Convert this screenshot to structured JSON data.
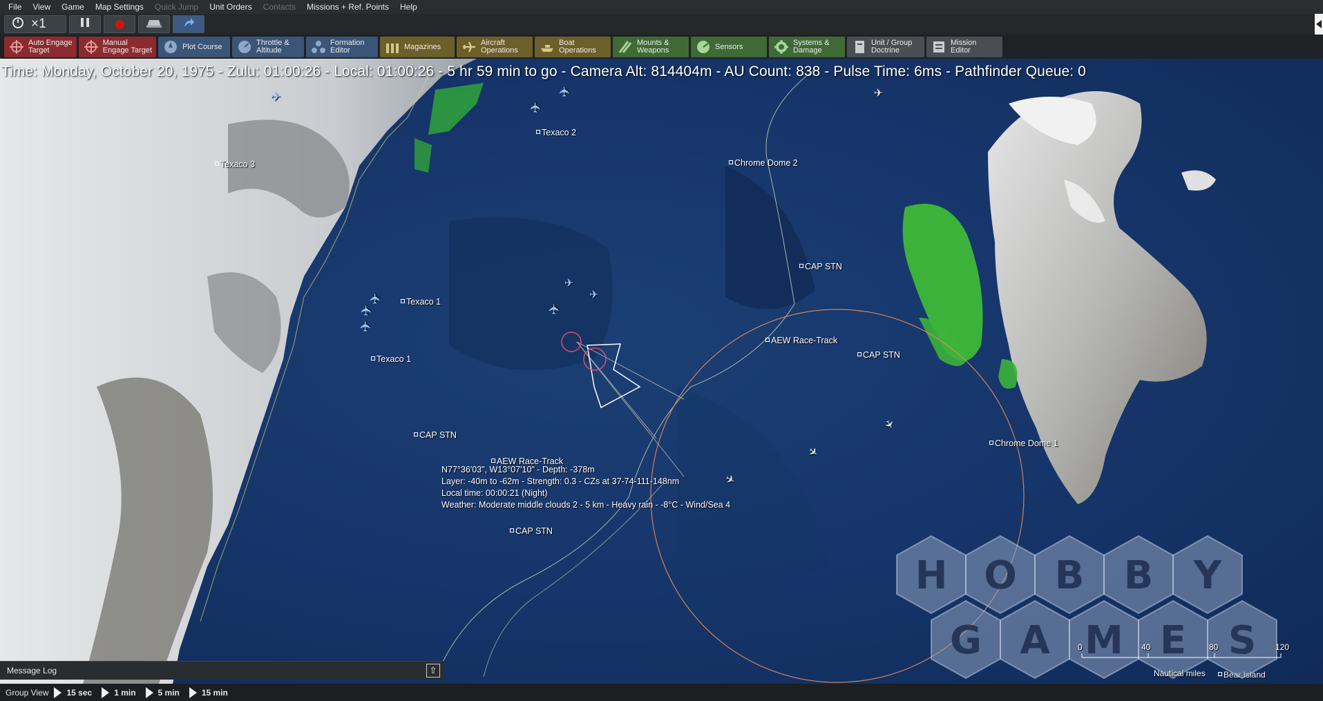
{
  "menu": {
    "items": [
      {
        "label": "File",
        "enabled": true
      },
      {
        "label": "View",
        "enabled": true
      },
      {
        "label": "Game",
        "enabled": true
      },
      {
        "label": "Map Settings",
        "enabled": true
      },
      {
        "label": "Quick Jump",
        "enabled": false
      },
      {
        "label": "Unit Orders",
        "enabled": true
      },
      {
        "label": "Contacts",
        "enabled": false
      },
      {
        "label": "Missions + Ref. Points",
        "enabled": true
      },
      {
        "label": "Help",
        "enabled": true
      }
    ]
  },
  "controls": {
    "speed": "×1"
  },
  "toolbar": {
    "items": [
      {
        "label": "Auto Engage\nTarget",
        "icon": "crosshair-icon",
        "color": "#8c2b2f"
      },
      {
        "label": "Manual\nEngage Target",
        "icon": "crosshair-icon",
        "color": "#8c2b2f"
      },
      {
        "label": "Plot Course",
        "icon": "compass-icon",
        "color": "#3b5578"
      },
      {
        "label": "Throttle &\nAltitude",
        "icon": "throttle-icon",
        "color": "#3b5578"
      },
      {
        "label": "Formation\nEditor",
        "icon": "formation-icon",
        "color": "#3b5578"
      },
      {
        "label": "Magazines",
        "icon": "ammo-icon",
        "color": "#6d5f2a"
      },
      {
        "label": "Aircraft\nOperations",
        "icon": "aircraft-icon",
        "color": "#6d5f2a"
      },
      {
        "label": "Boat\nOperations",
        "icon": "boat-icon",
        "color": "#6d5f2a"
      },
      {
        "label": "Mounts &\nWeapons",
        "icon": "weapons-icon",
        "color": "#3f6a35"
      },
      {
        "label": "Sensors",
        "icon": "radar-icon",
        "color": "#3f6a35"
      },
      {
        "label": "Systems &\nDamage",
        "icon": "gear-icon",
        "color": "#3f6a35"
      },
      {
        "label": "Unit / Group\nDoctrine",
        "icon": "document-icon",
        "color": "#4a4e52"
      },
      {
        "label": "Mission\nEditor",
        "icon": "editor-icon",
        "color": "#4a4e52"
      }
    ]
  },
  "status": {
    "text": "Time: Monday, October 20, 1975 - Zulu: 01:00:26 - Local: 01:00:26 - 5 hr 59 min to go -  Camera Alt: 814404m  - AU Count: 838 - Pulse Time: 6ms - Pathfinder Queue: 0"
  },
  "map": {
    "ref_points": [
      {
        "label": "Texaco 2"
      },
      {
        "label": "Texaco 3"
      },
      {
        "label": "Chrome Dome 2"
      },
      {
        "label": "CAP STN"
      },
      {
        "label": "Texaco 1"
      },
      {
        "label": "Texaco 1"
      },
      {
        "label": "AEW Race-Track"
      },
      {
        "label": "CAP STN"
      },
      {
        "label": "CAP STN"
      },
      {
        "label": "AEW Race-Track"
      },
      {
        "label": "Chrome Dome 1"
      },
      {
        "label": "CAP STN"
      },
      {
        "label": "Bear Island"
      }
    ],
    "tooltip": {
      "line1": "N77°36'03\", W13°07'10\" - Depth: -378m",
      "line2": "Layer: -40m to -62m - Strength: 0.3 - CZs at 37-74-111-148nm",
      "line3": "Local time: 00:00:21 (Night)",
      "line4": "Weather: Moderate middle clouds 2 - 5 km - Heavy rain - -8°C - Wind/Sea 4"
    },
    "scale": {
      "ticks": [
        "0",
        "40",
        "80",
        "120"
      ],
      "unit": "Nautical miles"
    },
    "watermark": {
      "row1": [
        "H",
        "O",
        "B",
        "B",
        "Y"
      ],
      "row2": [
        "G",
        "A",
        "M",
        "E",
        "S"
      ]
    }
  },
  "message_log": {
    "label": "Message Log"
  },
  "bottom": {
    "group_view": "Group View",
    "steps": [
      "15 sec",
      "1 min",
      "5 min",
      "15 min"
    ]
  }
}
